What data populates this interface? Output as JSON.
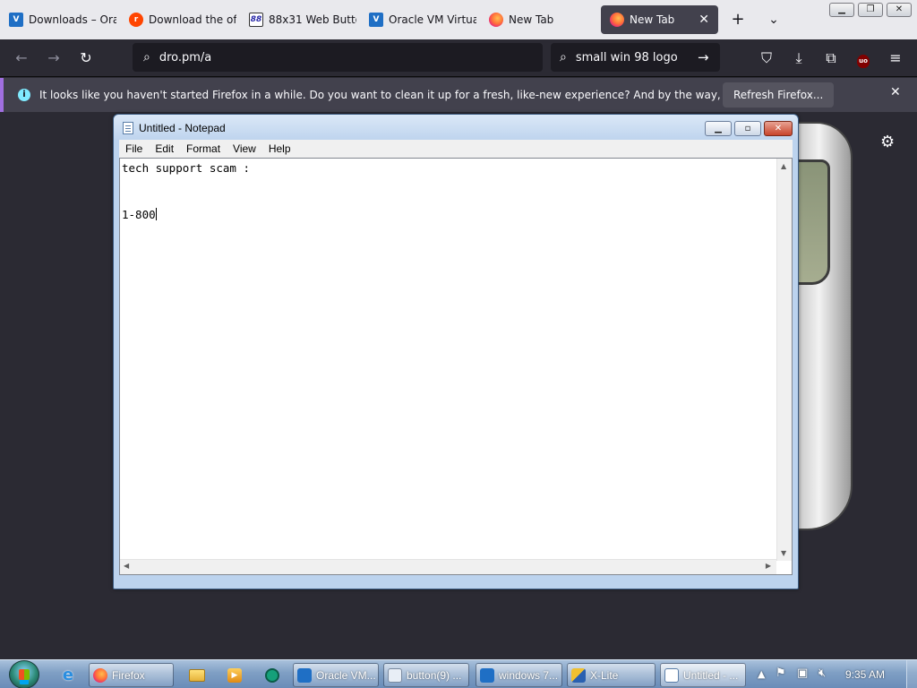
{
  "browser": {
    "tabs": [
      {
        "label": "Downloads – Ora",
        "icon": "virtualbox-icon"
      },
      {
        "label": "Download the of",
        "icon": "reddit-icon"
      },
      {
        "label": "88x31 Web Butto",
        "icon": "88x31-icon"
      },
      {
        "label": "Oracle VM Virtua",
        "icon": "virtualbox-icon"
      },
      {
        "label": "New Tab",
        "icon": "firefox-icon"
      },
      {
        "label": "New Tab",
        "icon": "firefox-icon",
        "active": true
      }
    ],
    "new_tab_symbol": "+",
    "tab_list_symbol": "⌄",
    "url": "dro.pm/a",
    "search_value": "small win 98 logo",
    "ublock_label": "uo"
  },
  "notification": {
    "message": "It looks like you haven't started Firefox in a while. Do you want to clean it up for a fresh, like-new experience? And by the way, welcome back!",
    "button_label": "Refresh Firefox..."
  },
  "notepad": {
    "title": "Untitled - Notepad",
    "menu": [
      "File",
      "Edit",
      "Format",
      "View",
      "Help"
    ],
    "text_line1": "tech support scam :",
    "text_line2": "",
    "text_line3": "1-800"
  },
  "taskbar": {
    "buttons": [
      {
        "label": "Firefox"
      },
      {
        "label": "Oracle VM..."
      },
      {
        "label": "button(9) ..."
      },
      {
        "label": "windows 7..."
      },
      {
        "label": "X-Lite"
      },
      {
        "label": "Untitled - ..."
      }
    ],
    "clock": "9:35 AM"
  },
  "colors": {
    "browser_bg": "#2b2a33",
    "tabstrip_bg": "#e9e9ed",
    "notification_accent": "#a06fe0",
    "taskbar_bg": "#7f9fc4"
  }
}
